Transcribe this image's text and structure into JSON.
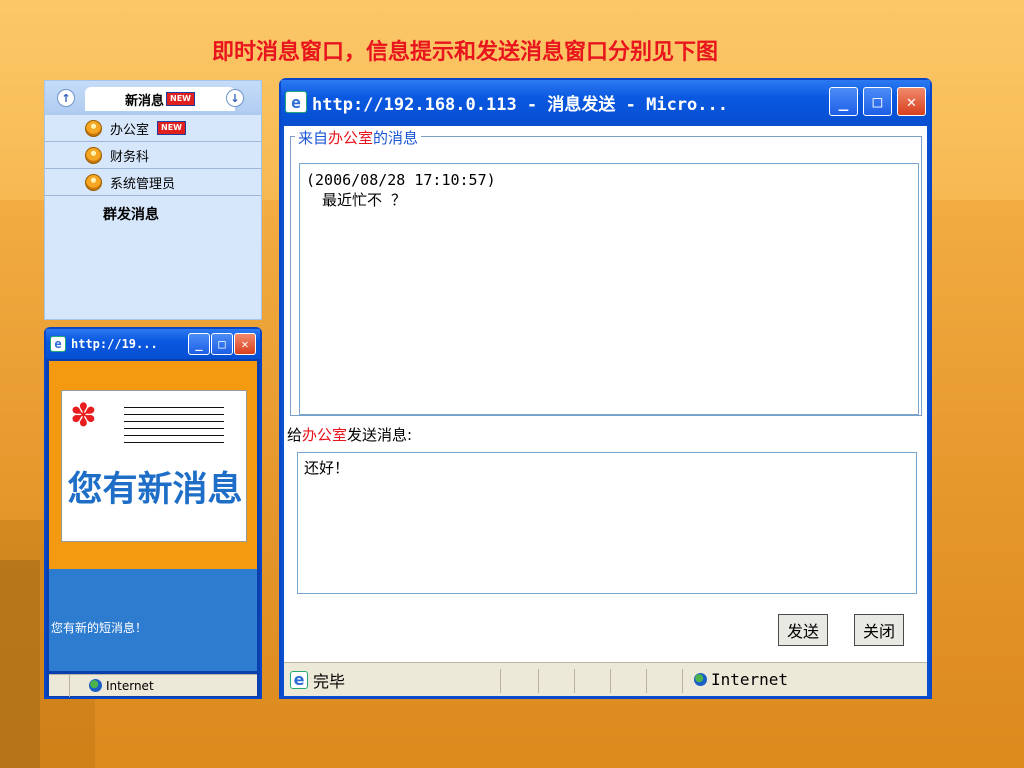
{
  "slide_title": "即时消息窗口，信息提示和发送消息窗口分别见下图",
  "contacts": {
    "header_label": "新消息",
    "new_badge": "NEW",
    "items": [
      {
        "label": "办公室",
        "badge": "NEW"
      },
      {
        "label": "财务科"
      },
      {
        "label": "系统管理员"
      }
    ],
    "group_label": "群发消息"
  },
  "popup": {
    "title": "http://19...",
    "banner_text": "您有新消息",
    "notice": "您有新的短消息！",
    "status_zone": "Internet"
  },
  "message_window": {
    "title": "http://192.168.0.113 - 消息发送 - Micro...",
    "legend_prefix": "来自",
    "sender": "办公室",
    "legend_suffix": "的消息",
    "timestamp": "(2006/08/28 17:10:57)",
    "received_text": "最近忙不 ？",
    "reply_prefix": "给",
    "reply_target": "办公室",
    "reply_suffix": "发送消息:",
    "reply_text": "还好！",
    "send_button": "发送",
    "close_button": "关闭",
    "status_text": "完毕",
    "status_zone": "Internet"
  },
  "colors": {
    "title_red": "#e8141e",
    "xp_blue": "#0a58e0",
    "legend_blue": "#1a56d6",
    "popup_orange": "#f39a10"
  }
}
